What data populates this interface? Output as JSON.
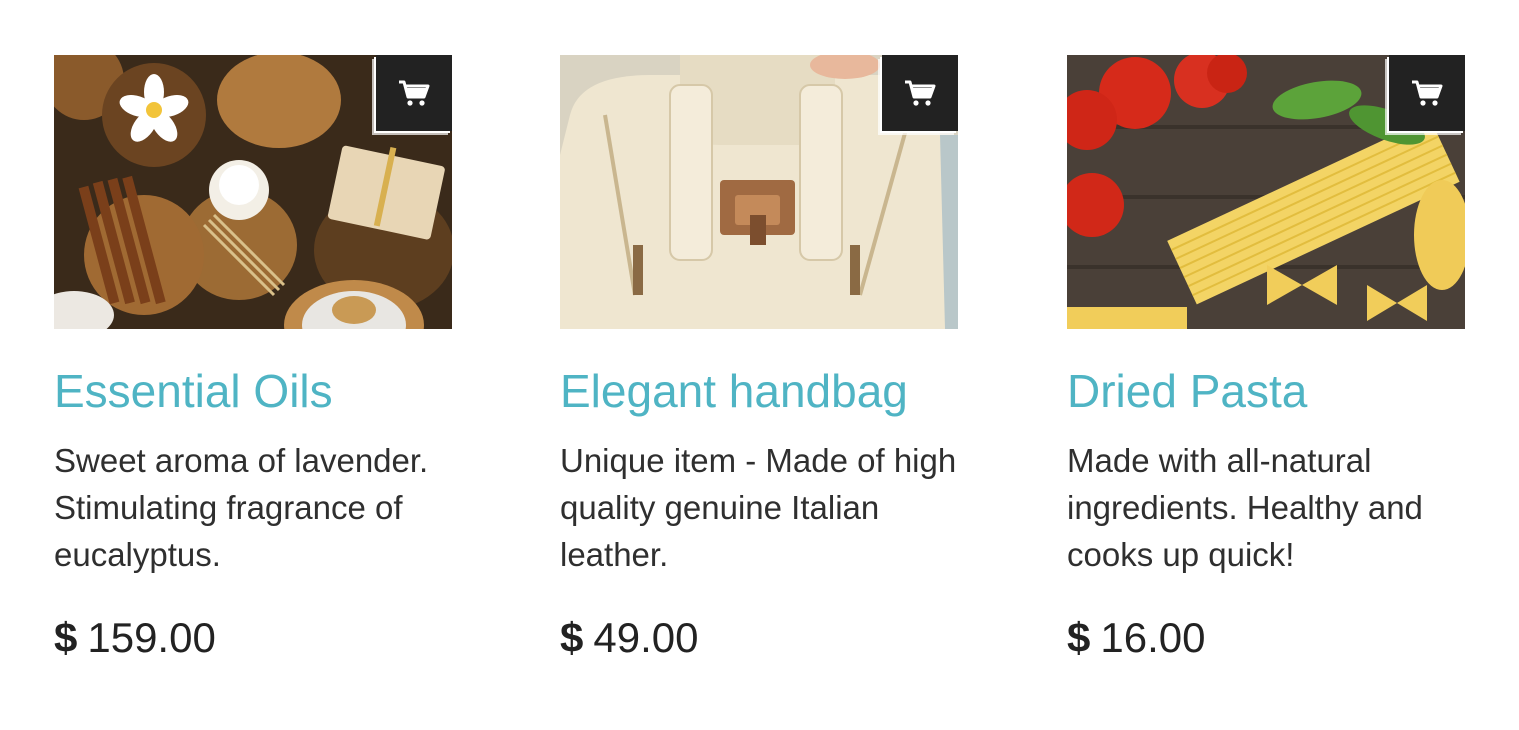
{
  "products": [
    {
      "name": "Essential Oils",
      "description": "Sweet aroma of lavender. Stimulating fragrance of eucalyptus.",
      "currency": "$",
      "price": "159.00",
      "image_subject": "spa-items-photo"
    },
    {
      "name": "Elegant handbag",
      "description": "Unique item - Made of high quality genuine Italian leather.",
      "currency": "$",
      "price": "49.00",
      "image_subject": "handbag-photo"
    },
    {
      "name": "Dried Pasta",
      "description": "Made with all-natural ingredients. Healthy and cooks up quick!",
      "currency": "$",
      "price": "16.00",
      "image_subject": "pasta-photo"
    }
  ],
  "icons": {
    "cart": "shopping-cart-icon"
  },
  "colors": {
    "title": "#4fb4c4",
    "text": "#2f2f2f",
    "cart_button_bg": "#222222"
  }
}
